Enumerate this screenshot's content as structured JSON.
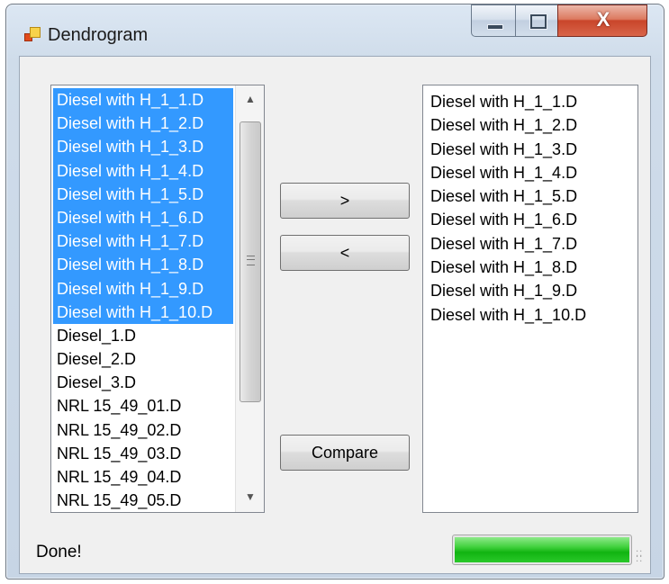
{
  "window": {
    "title": "Dendrogram",
    "controls": {
      "minimize_icon": "minimize-icon",
      "maximize_icon": "maximize-icon",
      "close_label": "X"
    }
  },
  "left_list": {
    "items": [
      {
        "label": "Diesel with H_1_1.D",
        "selected": true
      },
      {
        "label": "Diesel with H_1_2.D",
        "selected": true
      },
      {
        "label": "Diesel with H_1_3.D",
        "selected": true
      },
      {
        "label": "Diesel with H_1_4.D",
        "selected": true
      },
      {
        "label": "Diesel with H_1_5.D",
        "selected": true
      },
      {
        "label": "Diesel with H_1_6.D",
        "selected": true
      },
      {
        "label": "Diesel with H_1_7.D",
        "selected": true
      },
      {
        "label": "Diesel with H_1_8.D",
        "selected": true
      },
      {
        "label": "Diesel with H_1_9.D",
        "selected": true
      },
      {
        "label": "Diesel with H_1_10.D",
        "selected": true
      },
      {
        "label": "Diesel_1.D",
        "selected": false
      },
      {
        "label": "Diesel_2.D",
        "selected": false
      },
      {
        "label": "Diesel_3.D",
        "selected": false
      },
      {
        "label": "NRL 15_49_01.D",
        "selected": false
      },
      {
        "label": "NRL 15_49_02.D",
        "selected": false
      },
      {
        "label": "NRL 15_49_03.D",
        "selected": false
      },
      {
        "label": "NRL 15_49_04.D",
        "selected": false
      },
      {
        "label": "NRL 15_49_05.D",
        "selected": false
      }
    ],
    "scrollbar": {
      "up_glyph": "▲",
      "down_glyph": "▼"
    }
  },
  "buttons": {
    "move_right": ">",
    "move_left": "<",
    "compare": "Compare"
  },
  "right_list": {
    "items": [
      "Diesel with H_1_1.D",
      "Diesel with H_1_2.D",
      "Diesel with H_1_3.D",
      "Diesel with H_1_4.D",
      "Diesel with H_1_5.D",
      "Diesel with H_1_6.D",
      "Diesel with H_1_7.D",
      "Diesel with H_1_8.D",
      "Diesel with H_1_9.D",
      "Diesel with H_1_10.D"
    ]
  },
  "status": {
    "text": "Done!",
    "progress_percent": 100,
    "progress_color": "#11b411"
  },
  "colors": {
    "selection": "#3399ff",
    "selection_text": "#ffffff"
  }
}
